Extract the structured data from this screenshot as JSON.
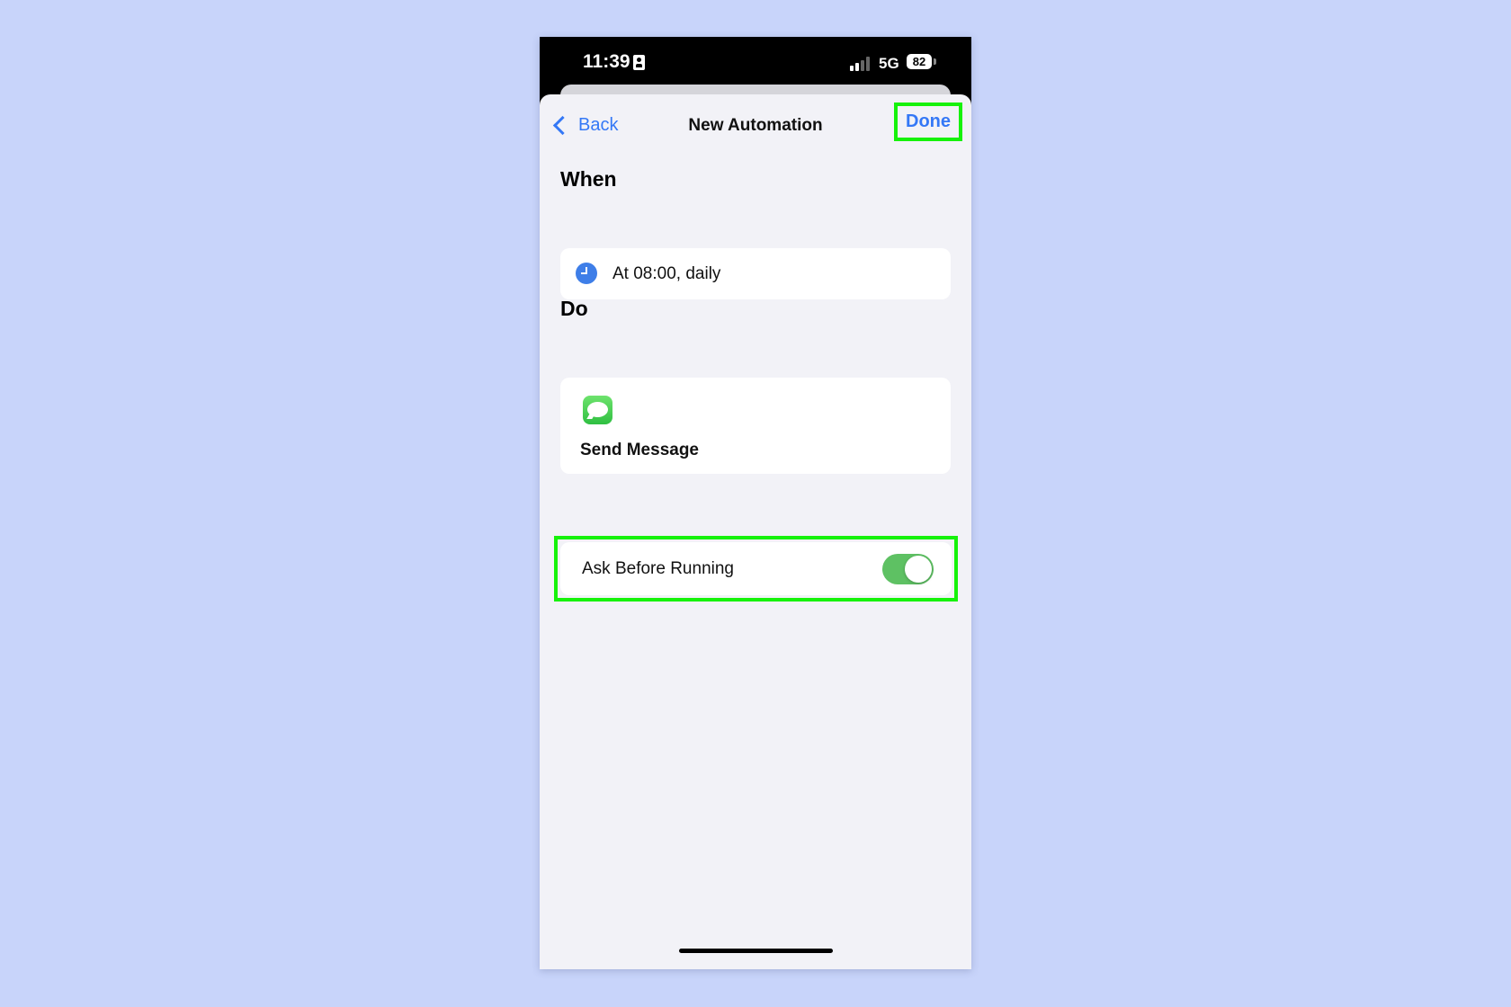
{
  "status_bar": {
    "time": "11:39",
    "network": "5G",
    "battery": "82"
  },
  "nav": {
    "back_label": "Back",
    "title": "New Automation",
    "done_label": "Done"
  },
  "when": {
    "header": "When",
    "trigger": "At 08:00, daily"
  },
  "do": {
    "header": "Do",
    "action": "Send Message"
  },
  "settings": {
    "ask_before_running": {
      "label": "Ask Before Running",
      "enabled": true
    }
  },
  "colors": {
    "accent": "#3478f6",
    "highlight": "#16f20a",
    "toggle_on": "#5ec163",
    "background": "#c8d4fa"
  },
  "icons": [
    "person-id-icon",
    "cellular-signal-icon",
    "battery-icon",
    "chevron-left-icon",
    "clock-icon",
    "messages-app-icon"
  ]
}
